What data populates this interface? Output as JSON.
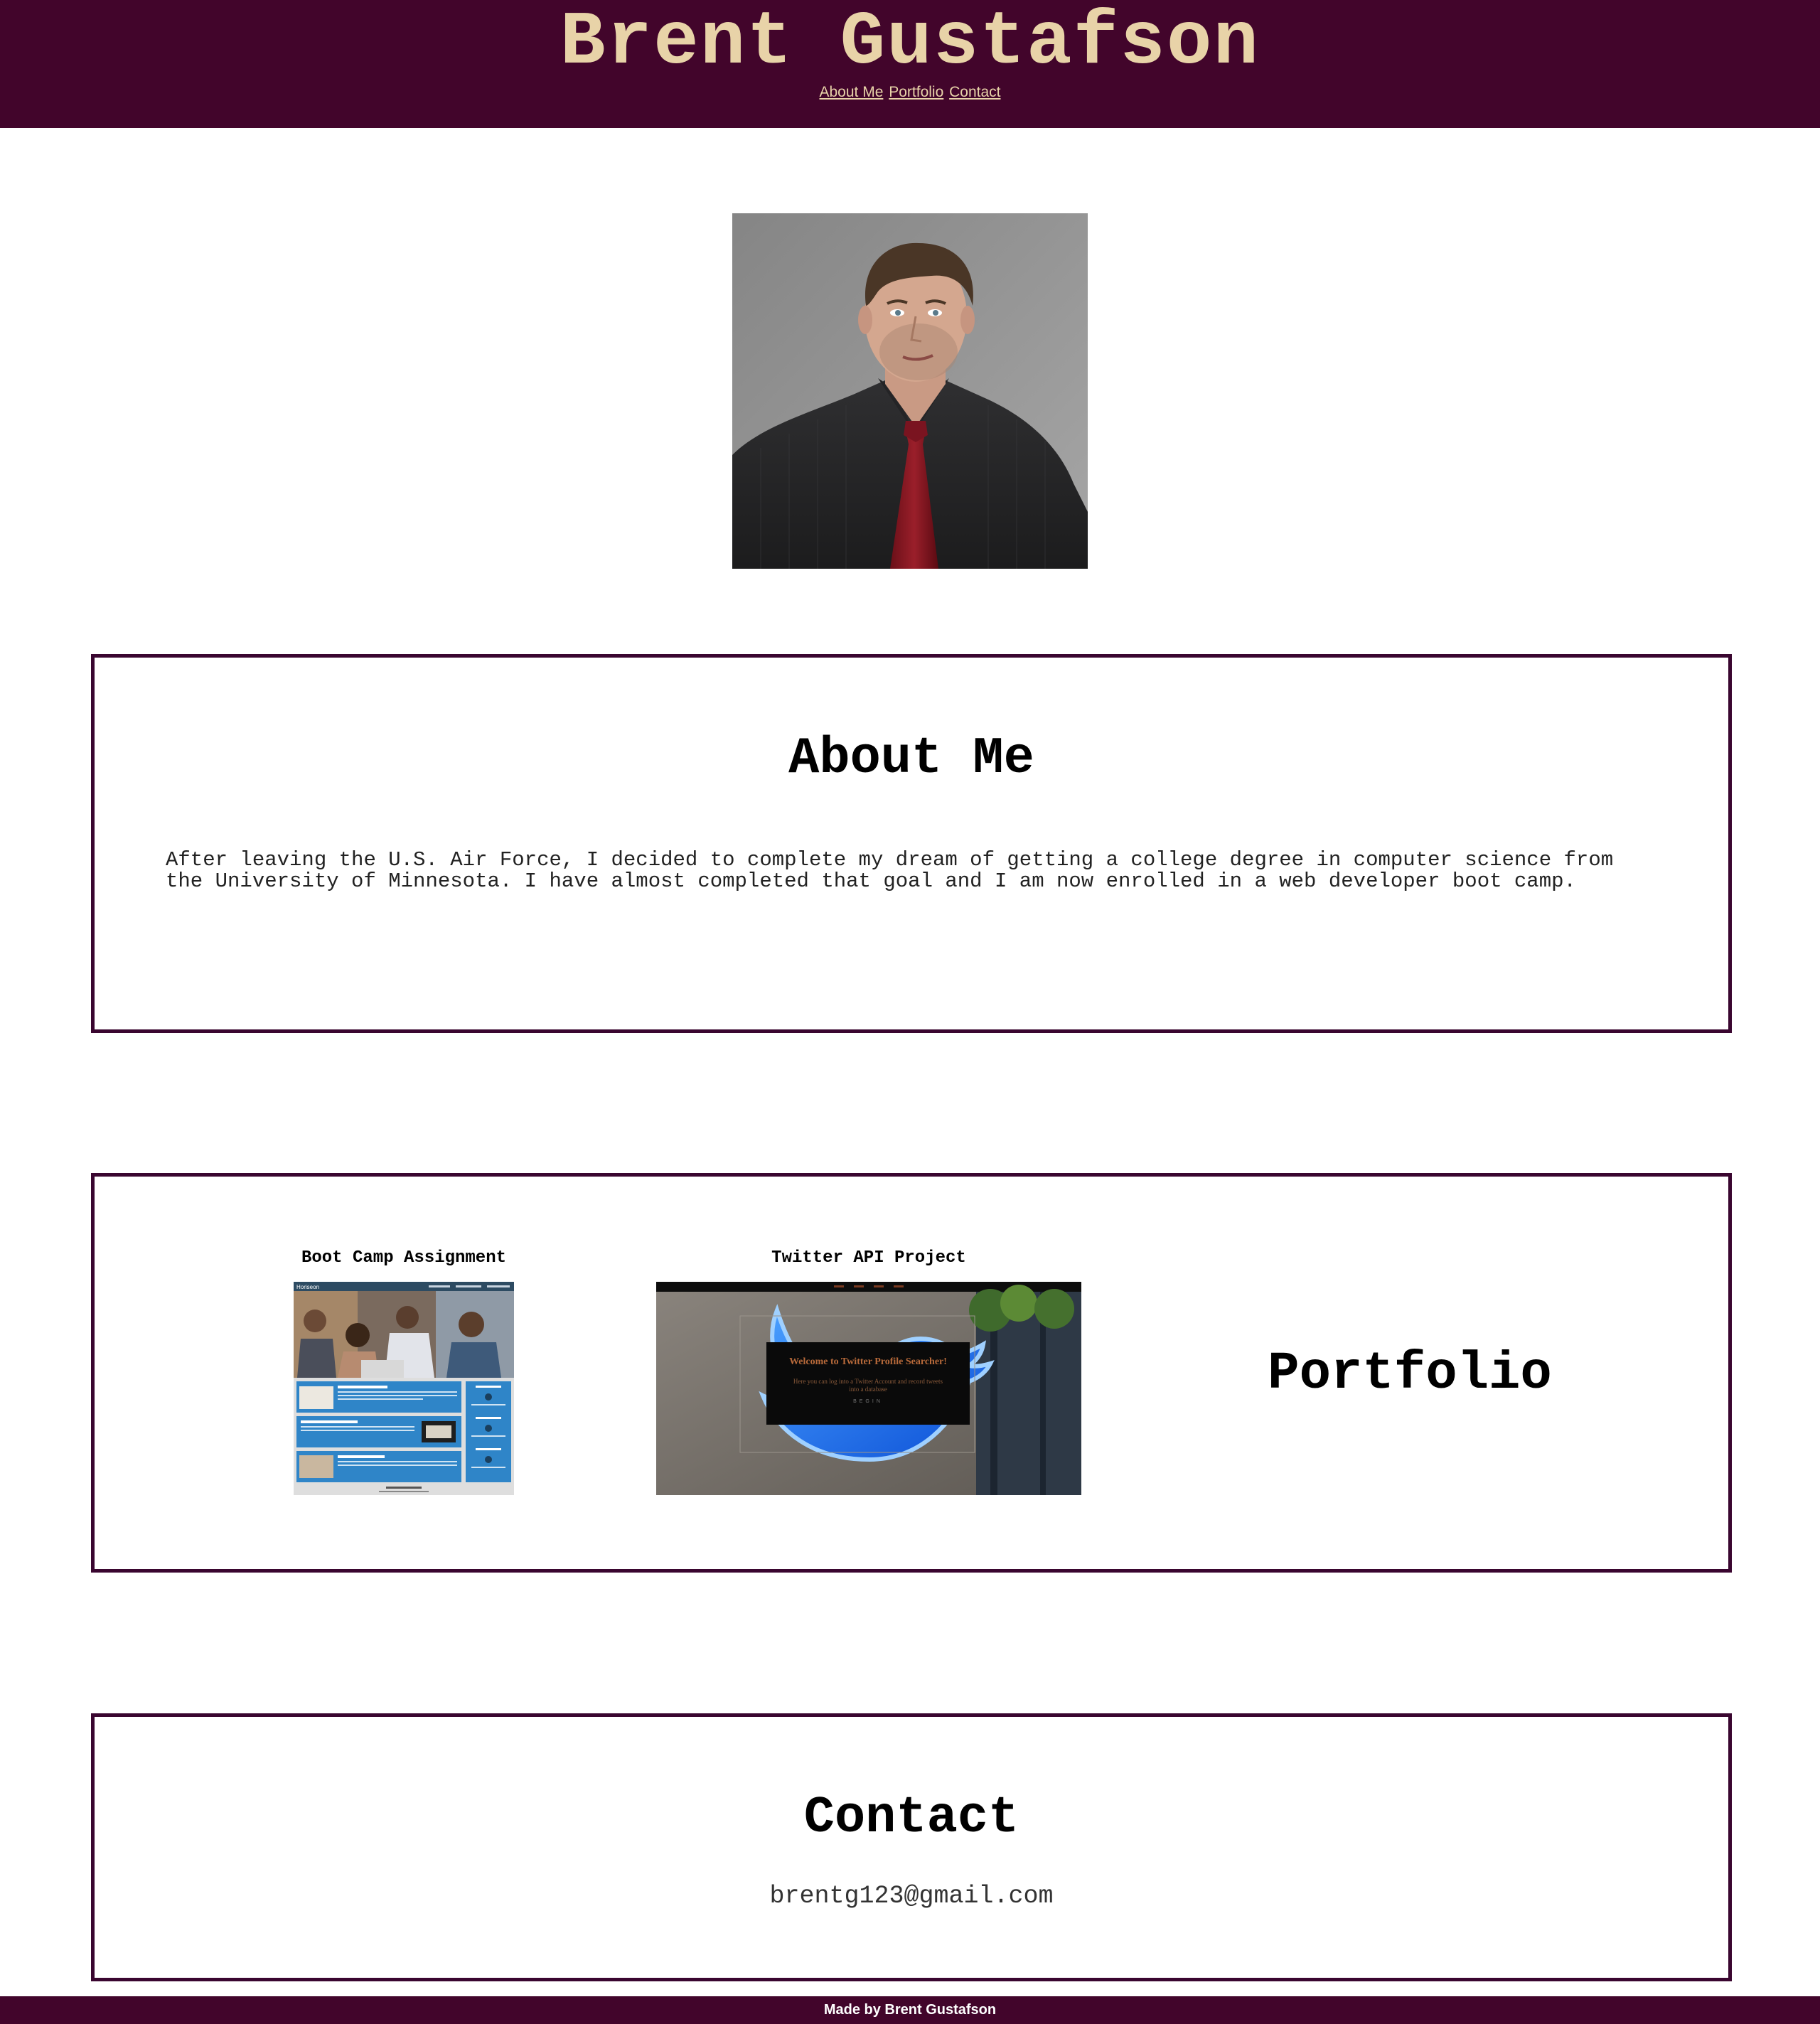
{
  "header": {
    "title": "Brent Gustafson",
    "nav": [
      "About Me",
      "Portfolio",
      "Contact"
    ]
  },
  "profile": {
    "photo_alt": "Portrait photo"
  },
  "about": {
    "heading": "About Me",
    "text": "After leaving the U.S. Air Force, I decided to complete my dream of getting a college degree in computer science from the University of Minnesota. I have almost completed that goal and I am now enrolled in a web developer boot camp."
  },
  "portfolio": {
    "heading": "Portfolio",
    "projects": [
      {
        "title": "Boot Camp Assignment",
        "thumb_brand": "Horiseon",
        "thumb_sections": [
          "Search Engine Optimization",
          "Online Reputation Management",
          "Social Media Marketing"
        ]
      },
      {
        "title": "Twitter API Project",
        "thumb_title": "Welcome to Twitter Profile Searcher!",
        "thumb_sub": "Here you can log into a Twitter Account and record tweets into a database",
        "thumb_button": "BEGIN"
      }
    ]
  },
  "contact": {
    "heading": "Contact",
    "email": "brentg123@gmail.com"
  },
  "footer": {
    "text": "Made by Brent Gustafson"
  },
  "colors": {
    "brand_maroon": "#42052b",
    "header_text": "#e8d3a8",
    "border": "#3a0630"
  }
}
